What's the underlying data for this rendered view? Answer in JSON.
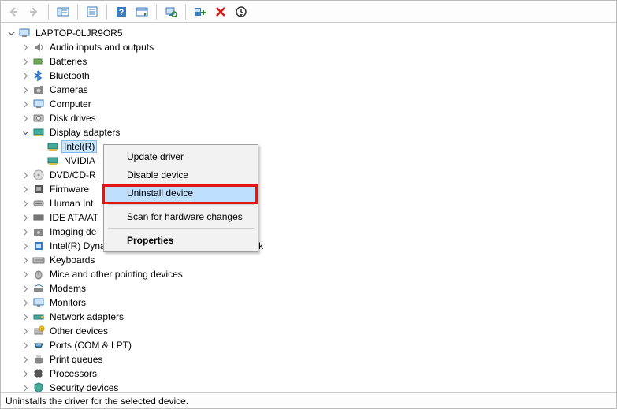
{
  "root": {
    "label": "LAPTOP-0LJR9OR5"
  },
  "categories": [
    {
      "label": "Audio inputs and outputs",
      "expanded": false
    },
    {
      "label": "Batteries",
      "expanded": false
    },
    {
      "label": "Bluetooth",
      "expanded": false
    },
    {
      "label": "Cameras",
      "expanded": false
    },
    {
      "label": "Computer",
      "expanded": false
    },
    {
      "label": "Disk drives",
      "expanded": false
    },
    {
      "label": "Display adapters",
      "expanded": true
    },
    {
      "label": "DVD/CD-R",
      "expanded": false
    },
    {
      "label": "Firmware",
      "expanded": false
    },
    {
      "label": "Human Int",
      "expanded": false
    },
    {
      "label": "IDE ATA/AT",
      "expanded": false
    },
    {
      "label": "Imaging de",
      "expanded": false
    },
    {
      "label": "Intel(R) Dynamic Platform and Thermal Framework",
      "expanded": false
    },
    {
      "label": "Keyboards",
      "expanded": false
    },
    {
      "label": "Mice and other pointing devices",
      "expanded": false
    },
    {
      "label": "Modems",
      "expanded": false
    },
    {
      "label": "Monitors",
      "expanded": false
    },
    {
      "label": "Network adapters",
      "expanded": false
    },
    {
      "label": "Other devices",
      "expanded": false
    },
    {
      "label": "Ports (COM & LPT)",
      "expanded": false
    },
    {
      "label": "Print queues",
      "expanded": false
    },
    {
      "label": "Processors",
      "expanded": false
    },
    {
      "label": "Security devices",
      "expanded": false
    }
  ],
  "display_children": [
    {
      "label": "Intel(R)",
      "selected": true
    },
    {
      "label": "NVIDIA",
      "selected": false
    }
  ],
  "context_menu": {
    "items": [
      {
        "label": "Update driver"
      },
      {
        "label": "Disable device"
      },
      {
        "label": "Uninstall device",
        "hover": true,
        "highlighted": true
      },
      {
        "sep": true
      },
      {
        "label": "Scan for hardware changes"
      },
      {
        "sep": true
      },
      {
        "label": "Properties",
        "bold": true
      }
    ]
  },
  "statusbar": {
    "text": "Uninstalls the driver for the selected device."
  }
}
